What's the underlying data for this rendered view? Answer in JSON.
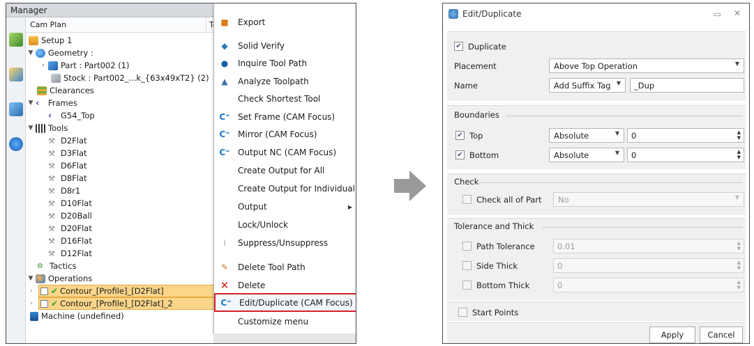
{
  "manager": {
    "title": "Manager",
    "col_cam_plan": "Cam Plan",
    "col_to": "To"
  },
  "tree": {
    "setup": "Setup 1",
    "geometry": "Geometry :",
    "part": "Part : Part002 (1)",
    "stock": "Stock : Part002_...k_{63x49xT2} (2)",
    "clearances": "Clearances",
    "frames": "Frames",
    "g54": "G54_Top",
    "tools": "Tools",
    "tool_items": [
      "D2Flat",
      "D3Flat",
      "D6Flat",
      "D8Flat",
      "D8r1",
      "D10Flat",
      "D20Ball",
      "D20Flat",
      "D16Flat",
      "D12Flat"
    ],
    "tactics": "Tactics",
    "operations": "Operations",
    "op1": "Contour_[Profile]_[D2Flat]",
    "op2": "Contour_[Profile]_[D2Flat]_2",
    "machine": "Machine (undefined)"
  },
  "context_menu": {
    "items": [
      "Export",
      "Solid Verify",
      "Inquire Tool Path",
      "Analyze Toolpath",
      "Check Shortest Tool",
      "Set Frame (CAM Focus)",
      "Mirror (CAM Focus)",
      "Output NC (CAM Focus)",
      "Create Output for All",
      "Create Output for Individual",
      "Output",
      "Lock/Unlock",
      "Suppress/Unsuppress",
      "Delete Tool Path",
      "Delete",
      "Edit/Duplicate (CAM Focus)",
      "Customize menu"
    ],
    "highlighted": "Edit/Duplicate (CAM Focus)"
  },
  "dialog": {
    "title": "Edit/Duplicate",
    "duplicate_label": "Duplicate",
    "duplicate_checked": true,
    "placement_label": "Placement",
    "placement_value": "Above Top Operation",
    "name_label": "Name",
    "name_mode": "Add Suffix Tag",
    "name_suffix": "_Dup",
    "boundaries_label": "Boundaries",
    "top_label": "Top",
    "top_checked": true,
    "top_mode": "Absolute",
    "top_value": "0",
    "bottom_label": "Bottom",
    "bottom_checked": true,
    "bottom_mode": "Absolute",
    "bottom_value": "0",
    "check_label": "Check",
    "check_all_label": "Check all of Part",
    "check_all_value": "No",
    "tolerance_label": "Tolerance and Thick",
    "path_tol_label": "Path Tolerance",
    "path_tol_value": "0.01",
    "side_thick_label": "Side Thick",
    "side_thick_value": "0",
    "bottom_thick_label": "Bottom Thick",
    "bottom_thick_value": "0",
    "start_points_label": "Start Points",
    "apply_label": "Apply",
    "cancel_label": "Cancel"
  },
  "colors": {
    "highlight_border": "#d4202b",
    "selected_row": "#fbd68a",
    "dialog_bg": "#f0f0f0"
  }
}
